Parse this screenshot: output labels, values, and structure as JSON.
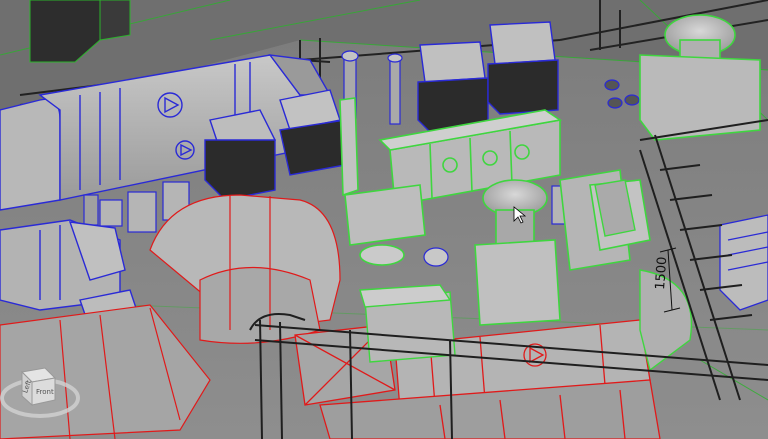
{
  "viewport": {
    "view_type": "3D MEP model viewport",
    "dimension": {
      "value": "1500"
    }
  },
  "view_cube": {
    "faces": [
      "Front",
      "Left"
    ]
  },
  "cursor": {
    "type": "arrow-pointer"
  },
  "colors": {
    "background": "#707070",
    "mechanical_selected": "#2a2ad6",
    "mechanical_hidden": "#e01a1a",
    "mechanical_highlight": "#3fd63f",
    "floor": "#8a8a8a",
    "equipment_face": "#b5b5b5",
    "equipment_dark": "#2a2a2a"
  }
}
